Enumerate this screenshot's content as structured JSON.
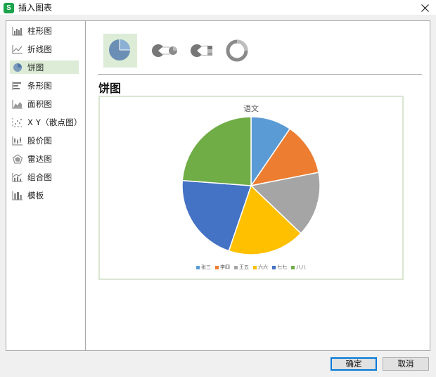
{
  "window": {
    "title": "插入图表",
    "logo_text": "S"
  },
  "sidebar": {
    "items": [
      {
        "label": "柱形图",
        "icon": "column-chart-icon",
        "active": false
      },
      {
        "label": "折线图",
        "icon": "line-chart-icon",
        "active": false
      },
      {
        "label": "饼图",
        "icon": "pie-chart-icon",
        "active": true
      },
      {
        "label": "条形图",
        "icon": "bar-chart-icon",
        "active": false
      },
      {
        "label": "面积图",
        "icon": "area-chart-icon",
        "active": false
      },
      {
        "label": "X Y（散点图）",
        "icon": "scatter-chart-icon",
        "active": false
      },
      {
        "label": "股价图",
        "icon": "stock-chart-icon",
        "active": false
      },
      {
        "label": "雷达图",
        "icon": "radar-chart-icon",
        "active": false
      },
      {
        "label": "组合图",
        "icon": "combo-chart-icon",
        "active": false
      },
      {
        "label": "模板",
        "icon": "template-icon",
        "active": false
      }
    ]
  },
  "subtypes": [
    {
      "name": "pie",
      "icon": "pie-subtype-icon",
      "active": true
    },
    {
      "name": "pie-of-pie",
      "icon": "pie-of-pie-subtype-icon",
      "active": false
    },
    {
      "name": "bar-of-pie",
      "icon": "bar-of-pie-subtype-icon",
      "active": false
    },
    {
      "name": "doughnut",
      "icon": "doughnut-subtype-icon",
      "active": false
    }
  ],
  "section_title": "饼图",
  "chart_data": {
    "type": "pie",
    "title": "语文",
    "categories": [
      "张三",
      "李四",
      "王五",
      "六六",
      "七七",
      "八八"
    ],
    "values": [
      10,
      13,
      16,
      19,
      22,
      25
    ],
    "colors": [
      "#5b9bd5",
      "#ed7d31",
      "#a5a5a5",
      "#ffc000",
      "#4472c4",
      "#70ad47"
    ],
    "start_angle": "12 o'clock, clockwise",
    "legend_position": "bottom"
  },
  "buttons": {
    "ok": "确定",
    "cancel": "取消"
  }
}
